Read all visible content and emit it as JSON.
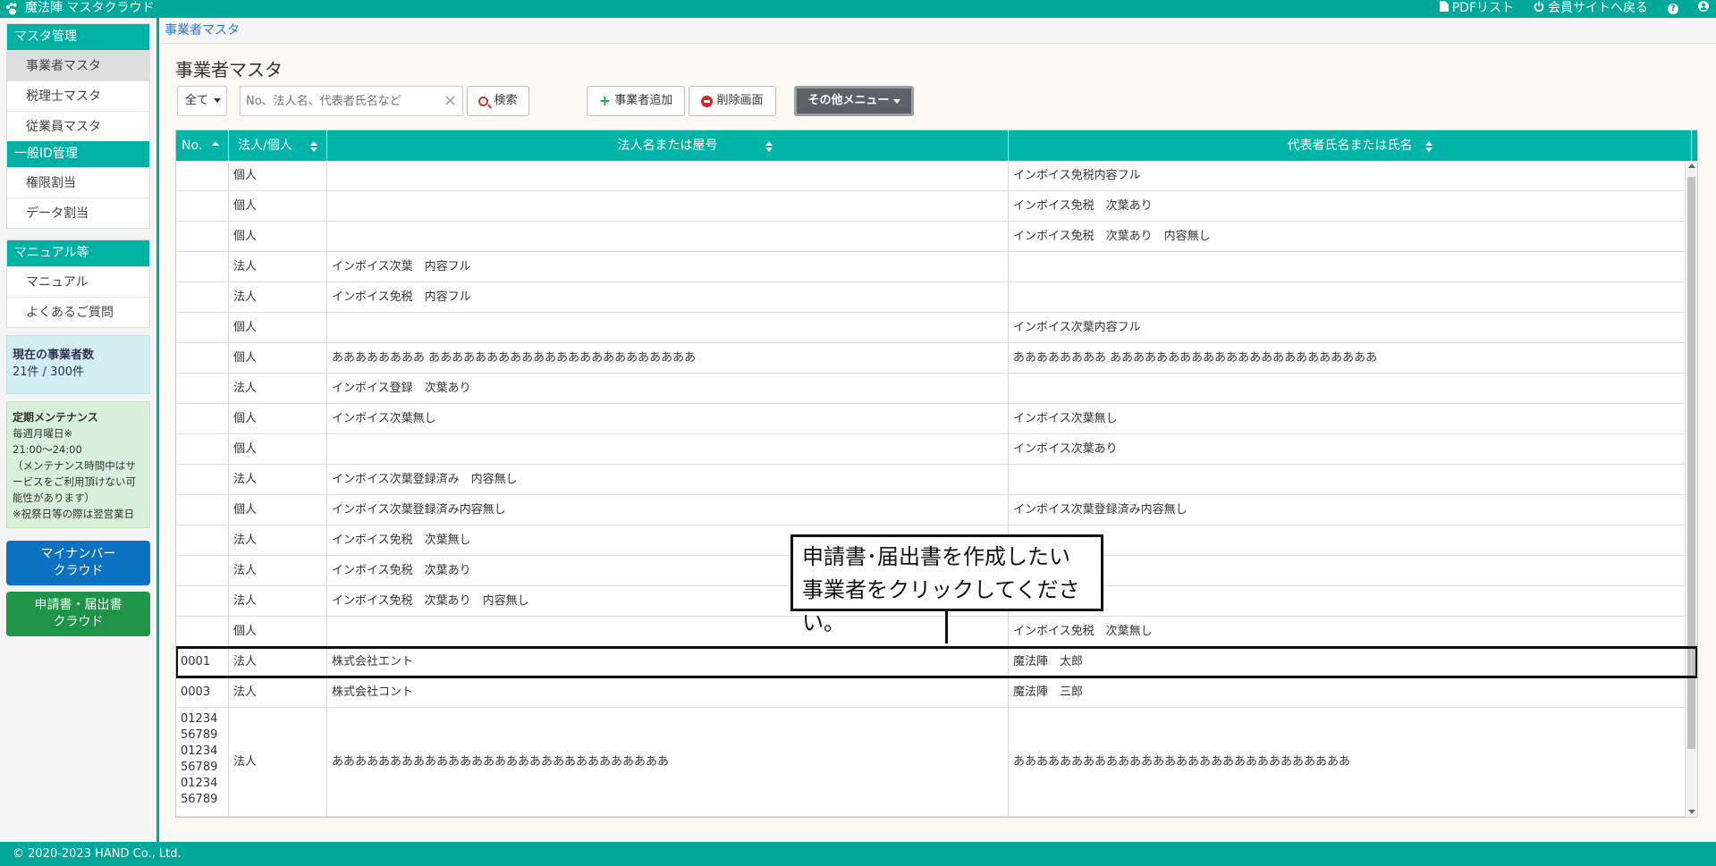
{
  "app": {
    "title": "魔法陣 マスタクラウド",
    "pdf_list": "PDFリスト",
    "member_site": "会員サイトへ戻る"
  },
  "sidebar": {
    "master_head": "マスタ管理",
    "master_items": [
      "事業者マスタ",
      "税理士マスタ",
      "従業員マスタ"
    ],
    "id_head": "一般ID管理",
    "id_items": [
      "権限割当",
      "データ割当"
    ],
    "manual_head": "マニュアル等",
    "manual_items": [
      "マニュアル",
      "よくあるご質問"
    ],
    "count_title": "現在の事業者数",
    "count_value": "21件 / 300件",
    "maint_title": "定期メンテナンス",
    "maint_lines": [
      "毎週月曜日※",
      "21:00〜24:00",
      "（メンテナンス時間中はサービスをご利用頂けない可能性があります）",
      "※祝祭日等の際は翌営業日"
    ],
    "btn_mynumber": "マイナンバー\nクラウド",
    "btn_shinsei": "申請書・届出書\nクラウド"
  },
  "breadcrumb": "事業者マスタ",
  "page_title": "事業者マスタ",
  "toolbar": {
    "select_value": "全て",
    "search_placeholder": "No、法人名、代表者氏名など",
    "search_label": "検索",
    "add_label": "事業者追加",
    "delete_label": "削除画面",
    "other_label": "その他メニュー"
  },
  "table": {
    "headers": [
      "No.",
      "法人/個人",
      "法人名または屋号",
      "代表者氏名または氏名"
    ],
    "rows": [
      [
        "",
        "個人",
        "",
        "インボイス免税内容フル"
      ],
      [
        "",
        "個人",
        "",
        "インボイス免税　次葉あり"
      ],
      [
        "",
        "個人",
        "",
        "インボイス免税　次葉あり　内容無し"
      ],
      [
        "",
        "法人",
        "インボイス次葉　内容フル",
        ""
      ],
      [
        "",
        "法人",
        "インボイス免税　内容フル",
        ""
      ],
      [
        "",
        "個人",
        "",
        "インボイス次葉内容フル"
      ],
      [
        "",
        "個人",
        "ああああああああ あああああああああああああああああああああああ",
        "ああああああああ あああああああああああああああああああああああ"
      ],
      [
        "",
        "法人",
        "インボイス登録　次葉あり",
        ""
      ],
      [
        "",
        "個人",
        "インボイス次葉無し",
        "インボイス次葉無し"
      ],
      [
        "",
        "個人",
        "",
        "インボイス次葉あり"
      ],
      [
        "",
        "法人",
        "インボイス次葉登録済み　内容無し",
        ""
      ],
      [
        "",
        "個人",
        "インボイス次葉登録済み内容無し",
        "インボイス次葉登録済み内容無し"
      ],
      [
        "",
        "法人",
        "インボイス免税　次葉無し",
        ""
      ],
      [
        "",
        "法人",
        "インボイス免税　次葉あり",
        ""
      ],
      [
        "",
        "法人",
        "インボイス免税　次葉あり　内容無し",
        ""
      ],
      [
        "",
        "個人",
        "",
        "インボイス免税　次葉無し"
      ],
      [
        "0001",
        "法人",
        "株式会社エント",
        "魔法陣　太郎"
      ],
      [
        "0003",
        "法人",
        "株式会社コント",
        "魔法陣　三郎"
      ],
      [
        "01234\n56789\n01234\n56789\n01234\n56789",
        "法人",
        "あああああああああああああああああああああああああああああ",
        "あああああああああああああああああああああああああああああ"
      ]
    ]
  },
  "callout": {
    "line1": "申請書･届出書を作成したい",
    "line2": "事業者をクリックしてください。"
  },
  "footer": "© 2020-2023 HAND Co., Ltd."
}
